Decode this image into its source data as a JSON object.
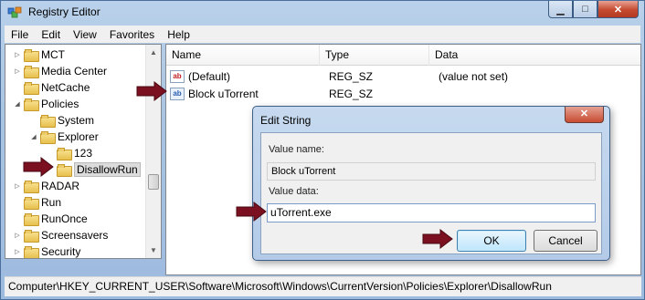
{
  "window": {
    "title": "Registry Editor"
  },
  "menu": [
    "File",
    "Edit",
    "View",
    "Favorites",
    "Help"
  ],
  "tree": [
    {
      "label": "MCT",
      "expander": "▷"
    },
    {
      "label": "Media Center",
      "expander": "▷"
    },
    {
      "label": "NetCache",
      "expander": ""
    },
    {
      "label": "Policies",
      "expander": "◢"
    },
    {
      "label": "System",
      "expander": ""
    },
    {
      "label": "Explorer",
      "expander": "◢"
    },
    {
      "label": "123",
      "expander": ""
    },
    {
      "label": "DisallowRun",
      "expander": ""
    },
    {
      "label": "RADAR",
      "expander": "▷"
    },
    {
      "label": "Run",
      "expander": ""
    },
    {
      "label": "RunOnce",
      "expander": ""
    },
    {
      "label": "Screensavers",
      "expander": "▷"
    },
    {
      "label": "Security",
      "expander": "▷"
    }
  ],
  "list": {
    "columns": [
      "Name",
      "Type",
      "Data"
    ],
    "rows": [
      {
        "name": "(Default)",
        "type": "REG_SZ",
        "data": "(value not set)",
        "icon": "ab"
      },
      {
        "name": "Block uTorrent",
        "type": "REG_SZ",
        "data": "",
        "icon": "ab"
      }
    ]
  },
  "status": "Computer\\HKEY_CURRENT_USER\\Software\\Microsoft\\Windows\\CurrentVersion\\Policies\\Explorer\\DisallowRun",
  "dialog": {
    "title": "Edit String",
    "value_name_label": "Value name:",
    "value_name": "Block uTorrent",
    "value_data_label": "Value data:",
    "value_data": "uTorrent.exe",
    "ok_label": "OK",
    "cancel_label": "Cancel"
  },
  "colors": {
    "callout_arrow": "#7a1020"
  }
}
